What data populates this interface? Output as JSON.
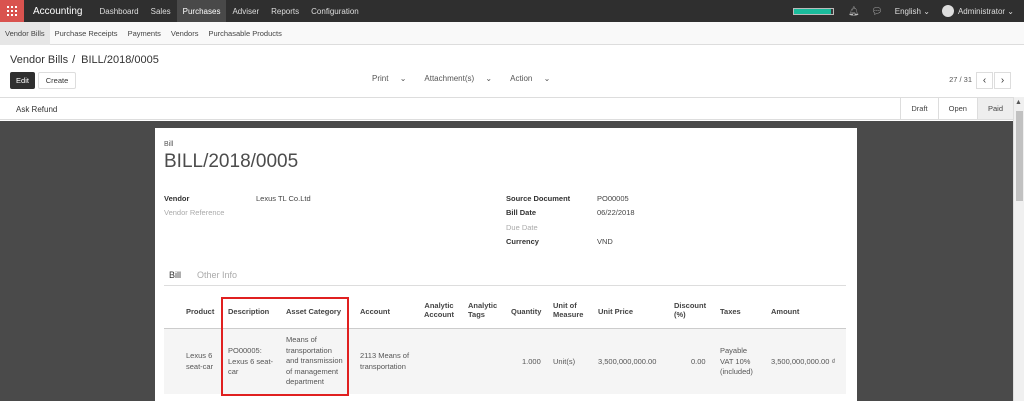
{
  "navbar": {
    "app_name": "Accounting",
    "menu": [
      "Dashboard",
      "Sales",
      "Purchases",
      "Adviser",
      "Reports",
      "Configuration"
    ],
    "active_menu": "Purchases",
    "progress_fraction": 0.95,
    "language": "English",
    "user": "Administrator"
  },
  "subnav": {
    "items": [
      "Vendor Bills",
      "Purchase Receipts",
      "Payments",
      "Vendors",
      "Purchasable Products"
    ],
    "active": "Vendor Bills"
  },
  "breadcrumb": {
    "parent": "Vendor Bills",
    "separator": "/",
    "current": "BILL/2018/0005"
  },
  "toolbar": {
    "edit_label": "Edit",
    "create_label": "Create",
    "print_label": "Print",
    "attachment_label": "Attachment(s)",
    "action_label": "Action",
    "pager": "27 / 31"
  },
  "statusbar": {
    "button": "Ask Refund",
    "stages": [
      "Draft",
      "Open",
      "Paid"
    ],
    "active_stage": "Paid"
  },
  "form": {
    "doc_type": "Bill",
    "title": "BILL/2018/0005",
    "vendor_label": "Vendor",
    "vendor_value": "Lexus TL Co.Ltd",
    "vendor_ref_label": "Vendor Reference",
    "source_doc_label": "Source Document",
    "source_doc_value": "PO00005",
    "bill_date_label": "Bill Date",
    "bill_date_value": "06/22/2018",
    "due_date_label": "Due Date",
    "currency_label": "Currency",
    "currency_value": "VND"
  },
  "tabs": [
    "Bill",
    "Other Info"
  ],
  "table": {
    "headers": {
      "product": "Product",
      "description": "Description",
      "asset_category": "Asset Category",
      "account": "Account",
      "analytic_account": [
        "Analytic",
        "Account"
      ],
      "analytic_tags": [
        "Analytic",
        "Tags"
      ],
      "quantity": "Quantity",
      "uom": [
        "Unit of",
        "Measure"
      ],
      "unit_price": "Unit Price",
      "discount": [
        "Discount",
        "(%)"
      ],
      "taxes": "Taxes",
      "amount": "Amount"
    },
    "row": {
      "product": [
        "Lexus 6",
        "seat-car"
      ],
      "description": [
        "PO00005:",
        "Lexus 6 seat-",
        "car"
      ],
      "asset_category": [
        "Means of",
        "transportation",
        "and transmission",
        "of management",
        "department"
      ],
      "account": [
        "2113 Means of",
        "transportation"
      ],
      "quantity": "1.000",
      "uom": "Unit(s)",
      "unit_price": "3,500,000,000.00",
      "discount": "0.00",
      "taxes": [
        "Payable",
        "VAT 10%",
        "(included)"
      ],
      "amount": "3,500,000,000.00 ₫"
    }
  },
  "colors": {
    "navbar": "#2f2f2f",
    "apps_button": "#d9534f",
    "highlight": "#e02020",
    "progress": "#1abc9c"
  }
}
